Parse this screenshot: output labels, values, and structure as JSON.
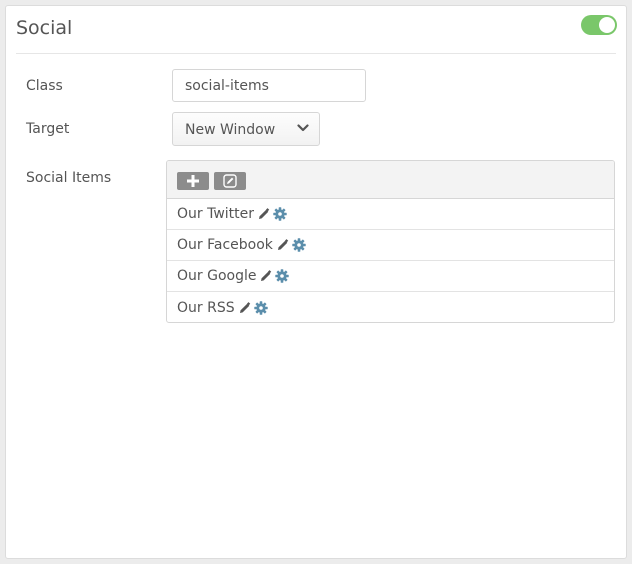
{
  "panel": {
    "title": "Social",
    "enabled_toggle": {
      "on": true,
      "color": "#7ac76a"
    }
  },
  "form": {
    "class_label": "Class",
    "class_value": "social-items",
    "target_label": "Target",
    "target_value": "New Window",
    "social_items_label": "Social Items"
  },
  "social_items": {
    "toolbar_buttons": [
      "plus-icon",
      "edit-icon"
    ],
    "items": [
      {
        "label": "Our Twitter"
      },
      {
        "label": "Our Facebook"
      },
      {
        "label": "Our Google"
      },
      {
        "label": "Our RSS"
      }
    ]
  },
  "colors": {
    "toggle_on": "#7ac76a",
    "gear_icon": "#5b8eab",
    "pencil_icon": "#555555",
    "toolbar_button": "#8c8c8c"
  }
}
